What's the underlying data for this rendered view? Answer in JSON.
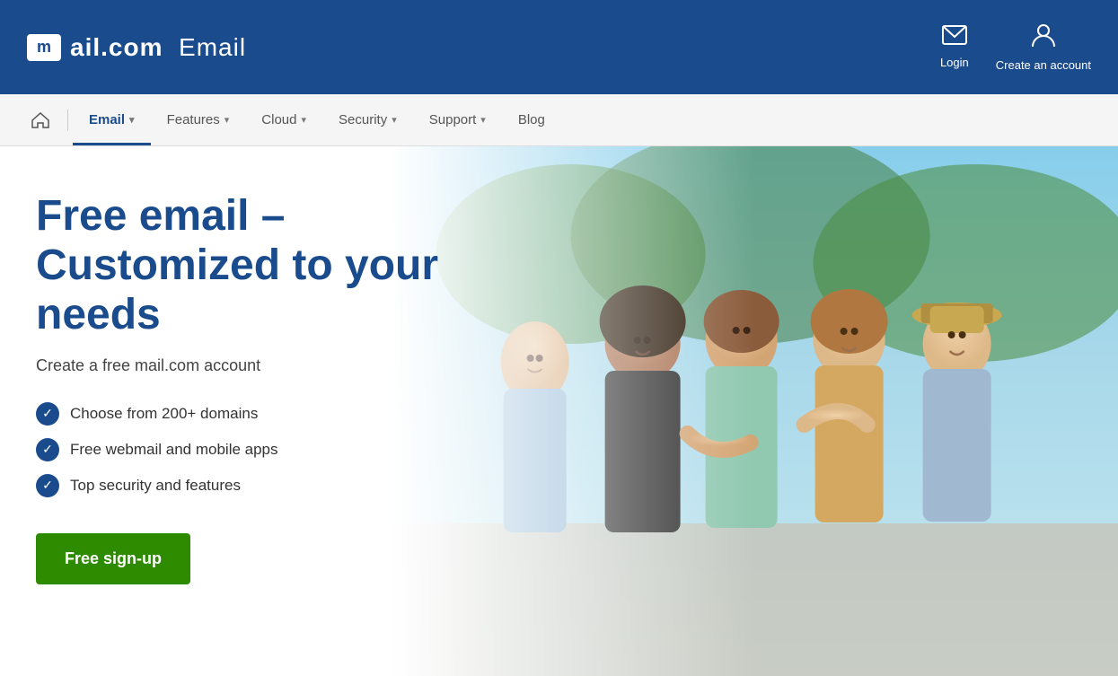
{
  "header": {
    "logo_m": "m",
    "logo_name": "ail.com",
    "logo_product": "Email",
    "login_label": "Login",
    "create_account_label": "Create an account",
    "login_icon": "✉",
    "account_icon": "👤"
  },
  "nav": {
    "home_icon": "⌂",
    "items": [
      {
        "label": "Email",
        "has_dropdown": true,
        "active": true
      },
      {
        "label": "Features",
        "has_dropdown": true,
        "active": false
      },
      {
        "label": "Cloud",
        "has_dropdown": true,
        "active": false
      },
      {
        "label": "Security",
        "has_dropdown": true,
        "active": false
      },
      {
        "label": "Support",
        "has_dropdown": true,
        "active": false
      }
    ],
    "blog_label": "Blog"
  },
  "hero": {
    "title": "Free email –\nCustomized to your needs",
    "subtitle": "Create a free mail.com account",
    "features": [
      "Choose from 200+ domains",
      "Free webmail and mobile apps",
      "Top security and features"
    ],
    "cta_label": "Free sign-up"
  }
}
